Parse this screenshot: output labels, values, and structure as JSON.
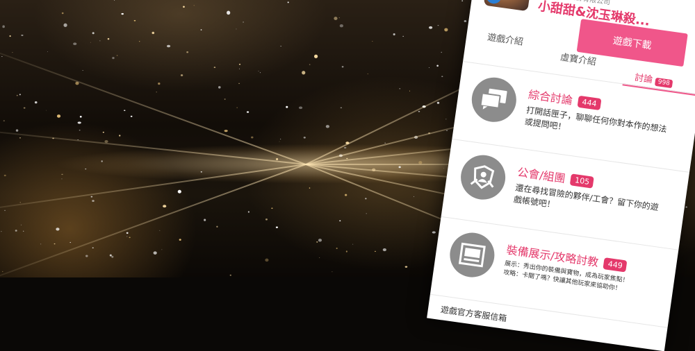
{
  "app": {
    "company": "島網科技股份有限公司",
    "title": "小甜甜&沈玉琳殺...",
    "download_label": "遊戲下載",
    "badge": "GG"
  },
  "tabs": [
    {
      "label": "遊戲介紹"
    },
    {
      "label": "虛寶介紹"
    },
    {
      "label": "討論",
      "count": "998"
    }
  ],
  "forums": [
    {
      "title": "綜合討論",
      "count": "444",
      "desc": "打開話匣子，聊聊任何你對本作的想法或提問吧！",
      "icon": "chat-bubbles-icon"
    },
    {
      "title": "公會/組團",
      "count": "105",
      "desc": "還在尋找冒險的夥伴/工會？留下你的遊戲帳號吧！",
      "icon": "guild-shield-icon"
    },
    {
      "title": "裝備展示/攻略討教",
      "count": "449",
      "desc_line1": "展示：秀出你的裝備與寶物，成為玩家焦點！",
      "desc_line2": "攻略：卡關了嗎？快讓其他玩家來協助你！",
      "icon": "equipment-display-icon"
    }
  ],
  "footer": {
    "label": "遊戲官方客服信箱"
  },
  "colors": {
    "accent": "#e4396b",
    "button": "#f0568a",
    "icon_gray": "#8c8c8c"
  }
}
